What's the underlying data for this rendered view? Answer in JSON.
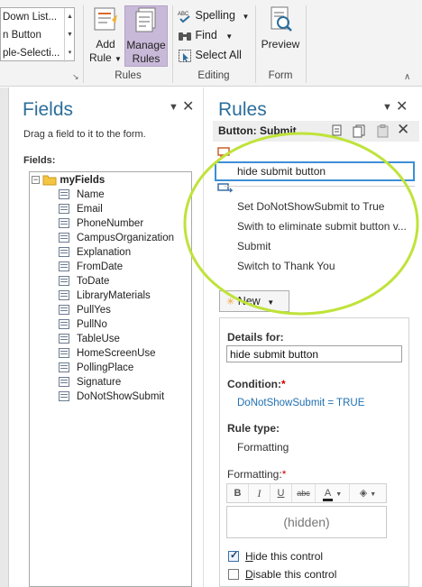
{
  "ribbon": {
    "gallery": {
      "items": [
        "Down List...",
        "n Button",
        "ple-Selecti..."
      ]
    },
    "rules_group": {
      "label": "Rules",
      "add_rule": "Add Rule",
      "add_rule_line1": "Add",
      "add_rule_line2": "Rule",
      "manage_rules_line1": "Manage",
      "manage_rules_line2": "Rules"
    },
    "editing_group": {
      "label": "Editing",
      "spelling": "Spelling",
      "find": "Find",
      "select_all": "Select All"
    },
    "form_group": {
      "label": "Form",
      "preview": "Preview"
    }
  },
  "fields_pane": {
    "title": "Fields",
    "instruction": "Drag a field to it to the form.",
    "fields_label": "Fields:",
    "root": "myFields",
    "items": [
      "Name",
      "Email",
      "PhoneNumber",
      "CampusOrganization",
      "Explanation",
      "FromDate",
      "ToDate",
      "LibraryMaterials",
      "PullYes",
      "PullNo",
      "TableUse",
      "HomeScreenUse",
      "PollingPlace",
      "Signature",
      "DoNotShowSubmit"
    ]
  },
  "rules_pane": {
    "title": "Rules",
    "subtitle": "Button: Submit",
    "selected_rule": "hide submit button",
    "action_rules": [
      "Set DoNotShowSubmit to True",
      "Swith to eliminate submit button v...",
      "Submit",
      "Switch to Thank You"
    ],
    "new_button": "New",
    "details": {
      "details_for_label": "Details for:",
      "name_value": "hide submit button",
      "condition_label": "Condition:",
      "condition_value": "DoNotShowSubmit = TRUE",
      "rule_type_label": "Rule type:",
      "rule_type_value": "Formatting",
      "formatting_label": "Formatting:",
      "preview_text": "(hidden)",
      "hide_control_label": "Hide this control",
      "hide_control_checked": true,
      "disable_control_label": "Disable this control",
      "disable_control_checked": false
    }
  },
  "colors": {
    "accent": "#2c6e9b",
    "highlight_circle": "#bfe33a",
    "selected_border": "#3c8fd6",
    "manage_rules_bg": "#c9b9d9",
    "condition_link": "#1f6fb2",
    "required": "#d00000"
  },
  "icons": {
    "add_rule": "add-rule-icon",
    "manage_rules": "manage-rules-icon",
    "spelling": "spelling-icon",
    "find": "binoculars-icon",
    "select_all": "select-all-icon",
    "preview": "preview-icon",
    "pane_menu": "chevron-down-icon",
    "pane_close": "close-icon",
    "folder": "folder-icon",
    "field": "field-icon",
    "condition_marker": "condition-icon",
    "action_marker": "action-icon",
    "copy": "copy-icon",
    "paste": "paste-icon",
    "delete": "delete-icon"
  }
}
